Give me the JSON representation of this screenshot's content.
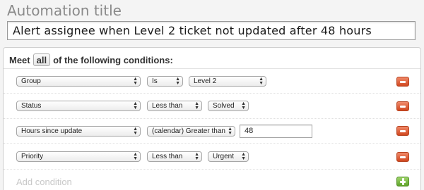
{
  "automation": {
    "title_label": "Automation title",
    "title_value": "Alert assignee when Level 2 ticket not updated after 48 hours"
  },
  "conditions_header": {
    "prefix": "Meet",
    "match_mode": "all",
    "suffix": "of the following conditions:"
  },
  "conditions": [
    {
      "field": "Group",
      "operator": "Is",
      "value": "Level 2",
      "value_type": "select"
    },
    {
      "field": "Status",
      "operator": "Less than",
      "value": "Solved",
      "value_type": "select"
    },
    {
      "field": "Hours since update",
      "operator": "(calendar) Greater than",
      "value": "48",
      "value_type": "text"
    },
    {
      "field": "Priority",
      "operator": "Less than",
      "value": "Urgent",
      "value_type": "select"
    }
  ],
  "add_condition_label": "Add condition",
  "colors": {
    "remove_button": "#d0471f",
    "add_button": "#5fa32a"
  }
}
